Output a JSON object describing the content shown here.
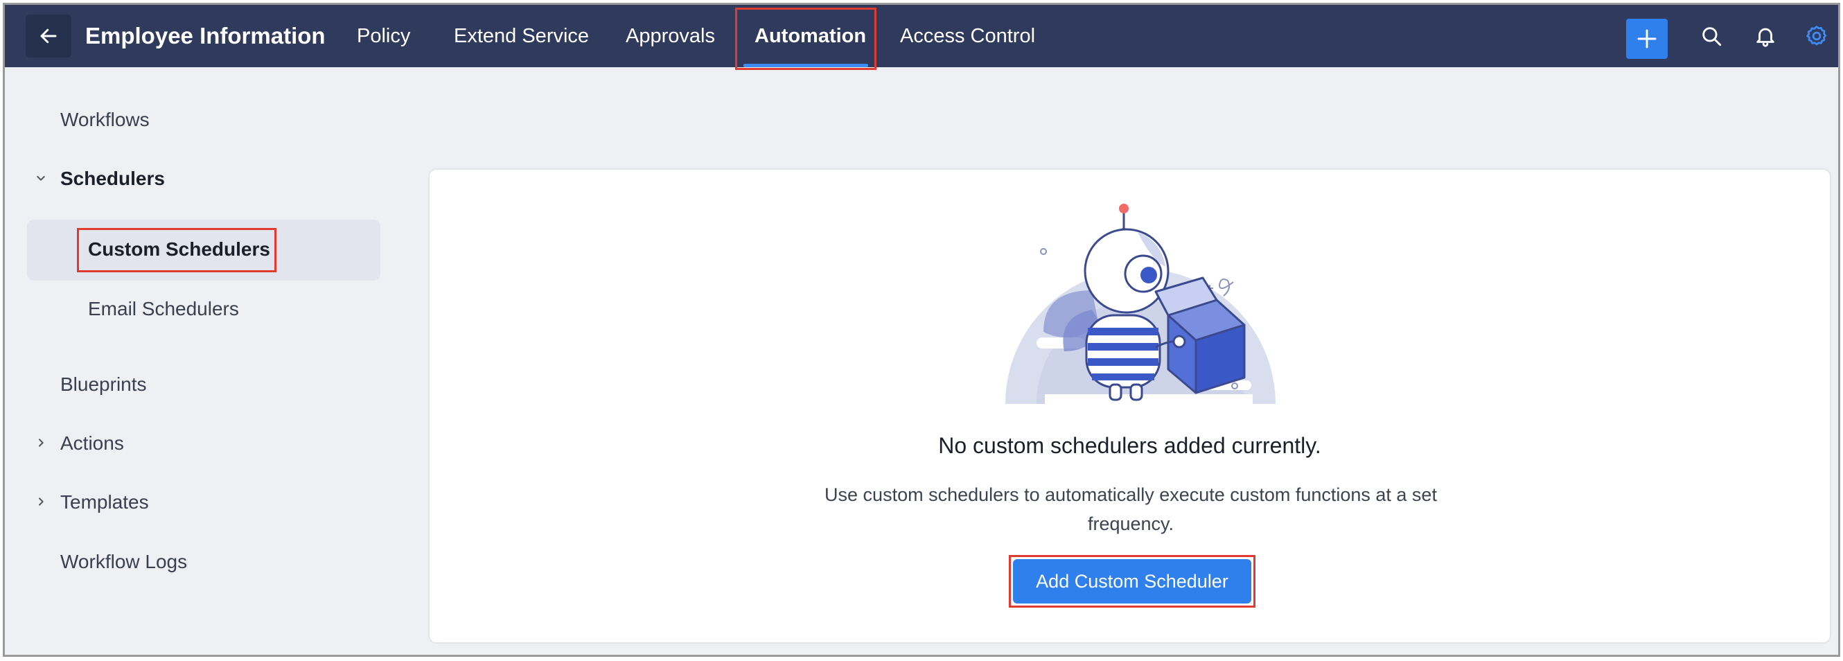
{
  "header": {
    "title": "Employee Information",
    "tabs": [
      {
        "label": "Policy"
      },
      {
        "label": "Extend Service"
      },
      {
        "label": "Approvals"
      },
      {
        "label": "Automation",
        "active": true
      },
      {
        "label": "Access Control"
      }
    ],
    "icons": [
      "back-arrow-icon",
      "plus-icon",
      "search-icon",
      "bell-icon",
      "gear-icon"
    ]
  },
  "sidebar": {
    "workflows": "Workflows",
    "schedulers": "Schedulers",
    "custom_schedulers": "Custom Schedulers",
    "email_schedulers": "Email Schedulers",
    "blueprints": "Blueprints",
    "actions": "Actions",
    "templates": "Templates",
    "workflow_logs": "Workflow Logs"
  },
  "main": {
    "empty_title": "No custom schedulers added currently.",
    "empty_desc": "Use custom schedulers to automatically execute custom functions at a set frequency.",
    "add_button": "Add Custom Scheduler"
  },
  "colors": {
    "topbar": "#2f3a5c",
    "accent": "#2f80ed",
    "highlight_border": "#e03b31",
    "page_bg": "#eef0f4"
  }
}
